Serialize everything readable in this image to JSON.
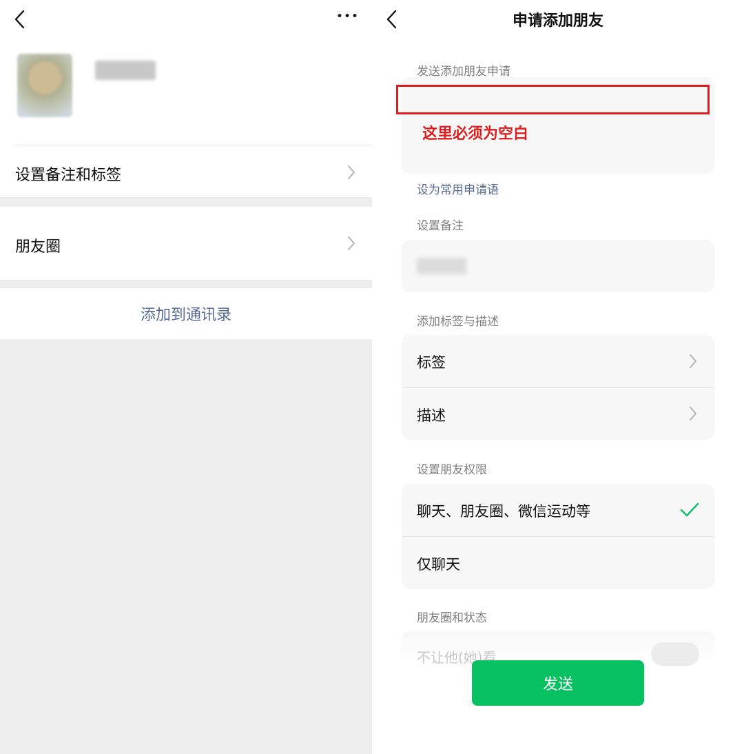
{
  "left": {
    "more_glyph": "•••",
    "rows": [
      {
        "label": "设置备注和标签"
      },
      {
        "label": "朋友圈"
      }
    ],
    "add_contact": "添加到通讯录"
  },
  "right": {
    "title": "申请添加朋友",
    "request_section": "发送添加朋友申请",
    "annotation": "这里必须为空白",
    "set_common": "设为常用申请语",
    "remark_section": "设置备注",
    "tags_section": "添加标签与描述",
    "tags_items": [
      {
        "label": "标签"
      },
      {
        "label": "描述"
      }
    ],
    "permission_section": "设置朋友权限",
    "permission_items": [
      {
        "label": "聊天、朋友圈、微信运动等",
        "selected": true
      },
      {
        "label": "仅聊天",
        "selected": false
      }
    ],
    "moments_section": "朋友圈和状态",
    "moments_item": "不让他(她)看",
    "send_label": "发送"
  },
  "colors": {
    "accent_green": "#07c160",
    "link_blue": "#576b95",
    "annotation_red": "#e01b1b"
  },
  "icons": [
    "back-icon",
    "more-icon",
    "chevron-right-icon",
    "checkmark-icon"
  ]
}
